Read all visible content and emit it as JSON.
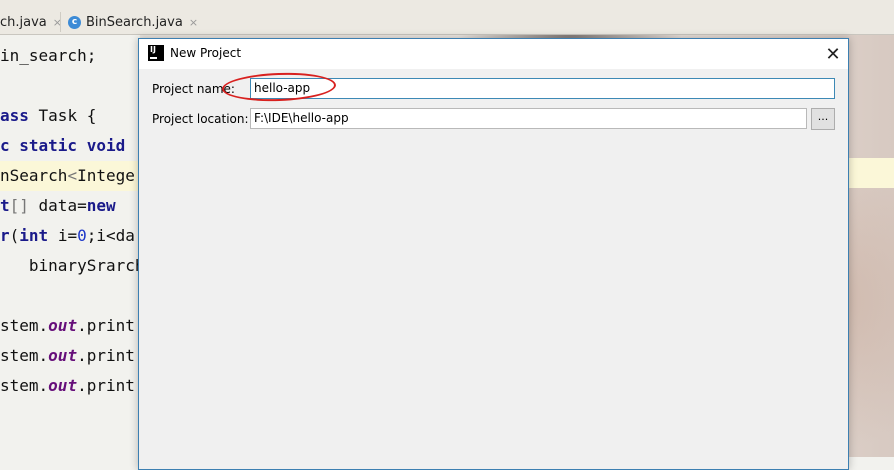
{
  "ide": {
    "tabs": [
      {
        "label": "ch.java",
        "close": "×"
      },
      {
        "label": "BinSearch.java",
        "close": "×"
      }
    ],
    "file_icon_letter": "c",
    "code_lines": [
      "in_search;",
      "",
      "ass Task {",
      "c static void",
      "nSearch<Intege",
      "t[] data=new ",
      "r(int i=0;i<da",
      "   binarySrarch",
      "",
      "stem.out.print",
      "stem.out.print",
      "stem.out.print"
    ]
  },
  "dialog": {
    "title": "New Project",
    "icon_text": "IJ",
    "close_symbol": "✕",
    "project_name_label": "Project name:",
    "project_name_value": "hello-app",
    "project_location_label": "Project location:",
    "project_location_value": "F:\\IDE\\hello-app",
    "browse_label": "..."
  },
  "colors": {
    "annotation": "#d8211f",
    "focus_border": "#3d89b5",
    "dialog_border": "#3c7fb1"
  }
}
